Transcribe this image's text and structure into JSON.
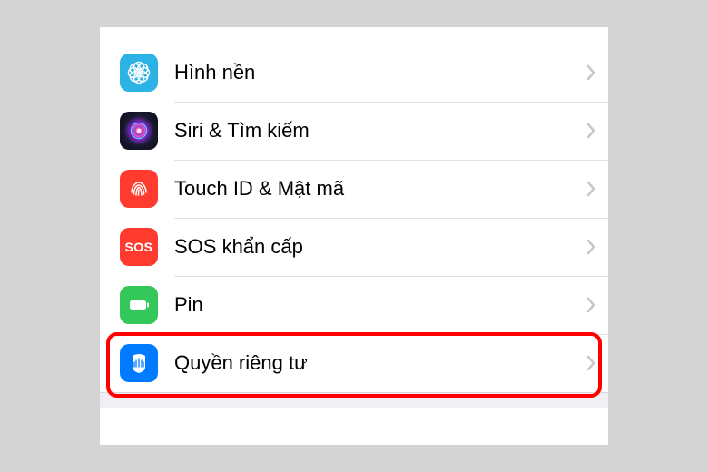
{
  "settings": {
    "items": [
      {
        "label": "Hình nền",
        "icon": "wallpaper-icon",
        "highlighted": false
      },
      {
        "label": "Siri & Tìm kiếm",
        "icon": "siri-icon",
        "highlighted": false
      },
      {
        "label": "Touch ID & Mật mã",
        "icon": "touchid-icon",
        "highlighted": false
      },
      {
        "label": "SOS khẩn cấp",
        "icon": "sos-icon",
        "highlighted": false
      },
      {
        "label": "Pin",
        "icon": "battery-icon",
        "highlighted": false
      },
      {
        "label": "Quyền riêng tư",
        "icon": "privacy-icon",
        "highlighted": true
      }
    ],
    "sos_abbrev": "SOS"
  },
  "colors": {
    "highlight_border": "#ff0000",
    "chevron": "#c7c7cc",
    "separator": "#e1e1e3"
  }
}
